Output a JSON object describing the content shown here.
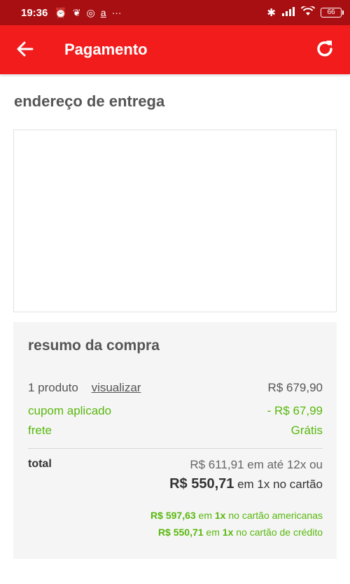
{
  "status_bar": {
    "time": "19:36",
    "left_icons": [
      "alarm-icon",
      "leaf-icon",
      "instagram-icon",
      "amazon-icon",
      "more-icon"
    ],
    "right_icons": [
      "bluetooth-icon",
      "signal-icon",
      "wifi-icon",
      "battery-icon"
    ],
    "battery_level": "66",
    "more": "···"
  },
  "app_bar": {
    "title": "Pagamento",
    "background": "#f21c1c"
  },
  "address": {
    "title": "endereço de entrega"
  },
  "summary": {
    "title": "resumo da compra",
    "products_label": "1 produto",
    "view_link": "visualizar",
    "products_value": "R$ 679,90",
    "coupon_label": "cupom aplicado",
    "coupon_value": "- R$ 67,99",
    "shipping_label": "frete",
    "shipping_value": "Grátis",
    "total_label": "total",
    "installment_text": "R$ 611,91 em até 12x ou",
    "cash_value": "R$ 550,71",
    "cash_suffix": " em 1x no cartão",
    "offer1_value": "R$ 597,63",
    "offer1_mid": " em ",
    "offer1_times": "1x",
    "offer1_suffix": " no cartão americanas",
    "offer2_value": "R$ 550,71",
    "offer2_mid": " em ",
    "offer2_times": "1x",
    "offer2_suffix": " no cartão de crédito",
    "accent_green": "#59b80e"
  }
}
